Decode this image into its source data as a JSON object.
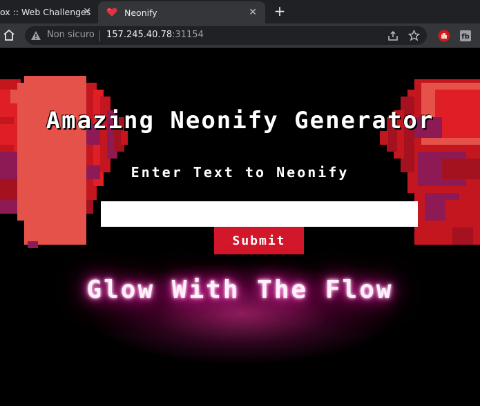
{
  "browser": {
    "tabs": [
      {
        "title": "ox :: Web Challenges",
        "active": false
      },
      {
        "title": "Neonify",
        "active": true
      }
    ],
    "new_tab_symbol": "+",
    "close_symbol": "✕",
    "security_label": "Non sicuro",
    "url_host": "157.245.40.78",
    "url_port": ":31154",
    "icons": [
      "home-icon",
      "warning-icon",
      "share-icon",
      "star-icon",
      "ublock-icon",
      "extension-icon"
    ]
  },
  "page": {
    "title": "Amazing Neonify Generator",
    "subtitle": "Enter Text to Neonify",
    "input_value": "",
    "submit_label": "Submit",
    "neon_text": "Glow With The Flow"
  },
  "colors": {
    "background": "#000000",
    "submit_bg": "#d2172a",
    "neon_glow": "#ff2fb3",
    "wing_red": "#e01e26",
    "wing_purple": "#8e1a55"
  }
}
